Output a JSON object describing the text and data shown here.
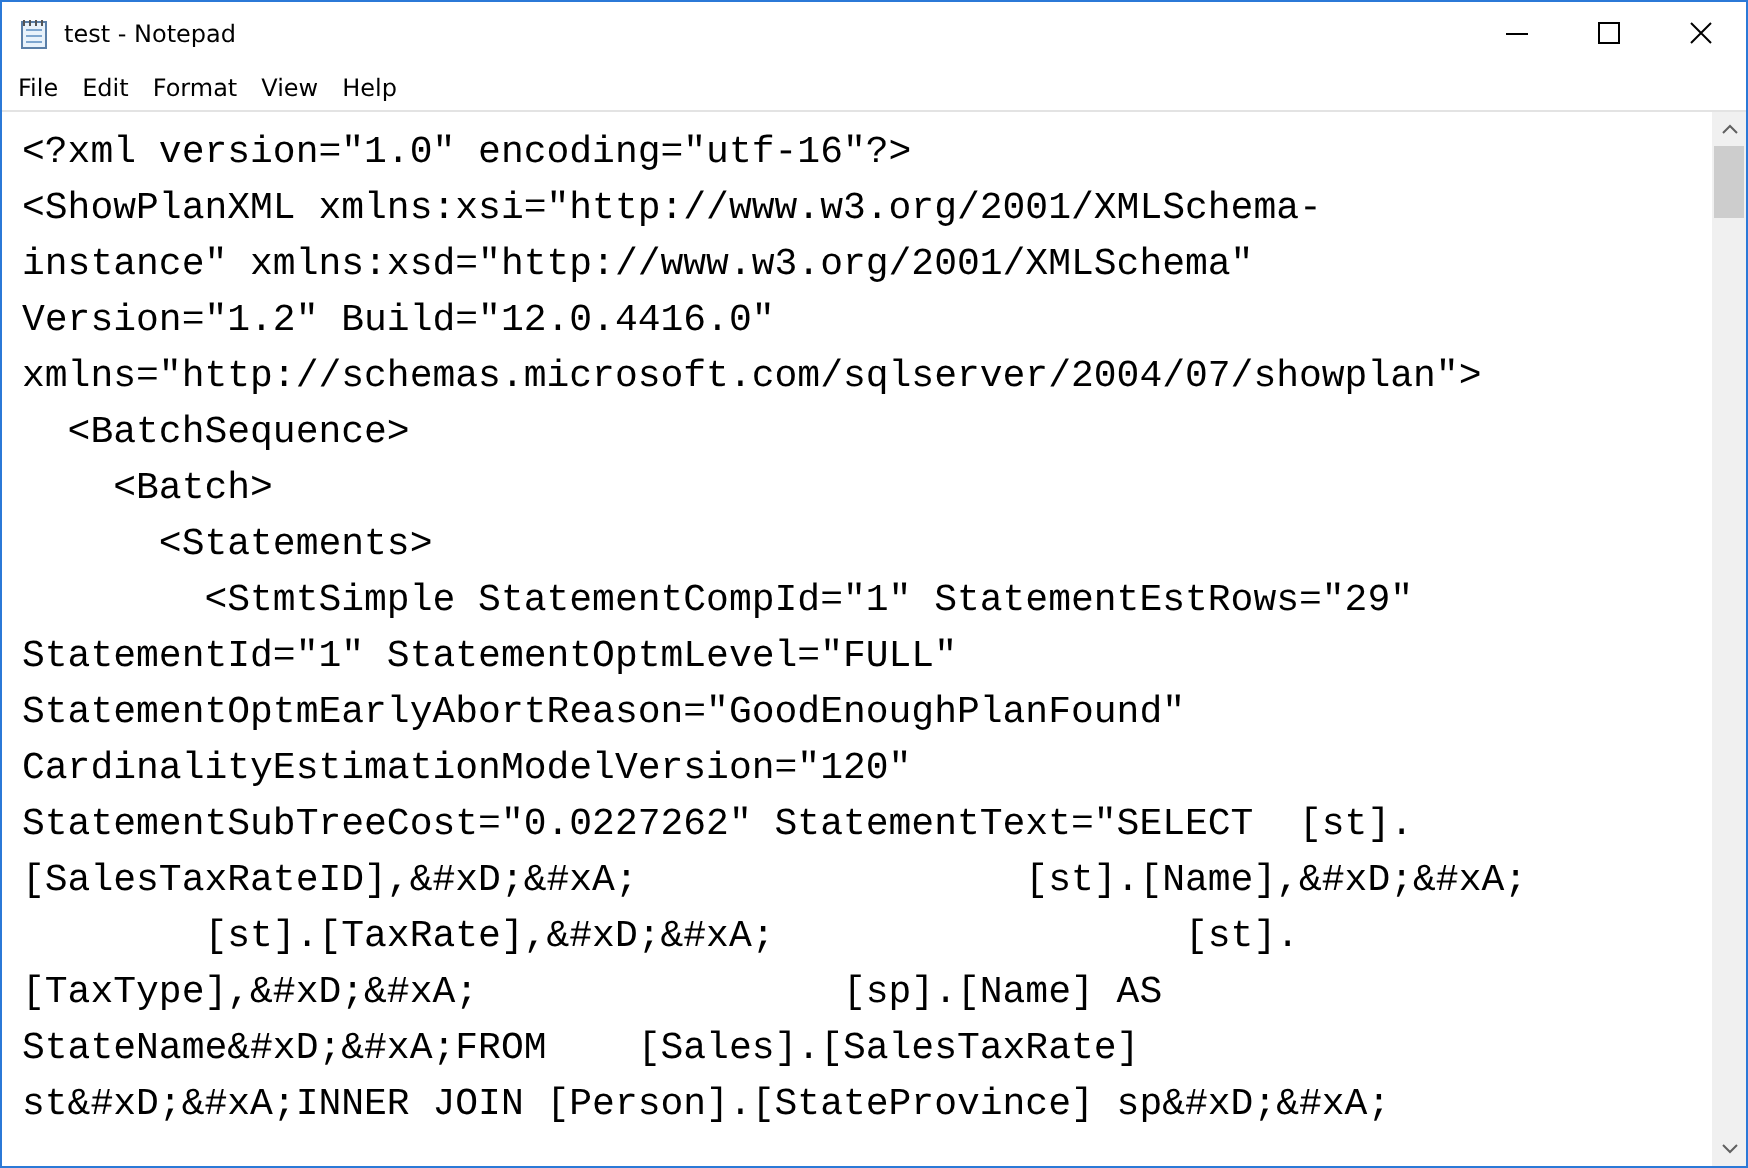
{
  "window": {
    "title": "test - Notepad"
  },
  "menu": [
    "File",
    "Edit",
    "Format",
    "View",
    "Help"
  ],
  "editor": {
    "lines": [
      "<?xml version=\"1.0\" encoding=\"utf-16\"?>",
      "<ShowPlanXML xmlns:xsi=\"http://www.w3.org/2001/XMLSchema-",
      "instance\" xmlns:xsd=\"http://www.w3.org/2001/XMLSchema\"",
      "Version=\"1.2\" Build=\"12.0.4416.0\"",
      "xmlns=\"http://schemas.microsoft.com/sqlserver/2004/07/showplan\">",
      "  <BatchSequence>",
      "    <Batch>",
      "      <Statements>",
      "        <StmtSimple StatementCompId=\"1\" StatementEstRows=\"29\"",
      "StatementId=\"1\" StatementOptmLevel=\"FULL\"",
      "StatementOptmEarlyAbortReason=\"GoodEnoughPlanFound\"",
      "CardinalityEstimationModelVersion=\"120\"",
      "StatementSubTreeCost=\"0.0227262\" StatementText=\"SELECT  [st].",
      "[SalesTaxRateID],&#xD;&#xA;                 [st].[Name],&#xD;&#xA;",
      "        [st].[TaxRate],&#xD;&#xA;                  [st].",
      "[TaxType],&#xD;&#xA;                [sp].[Name] AS",
      "StateName&#xD;&#xA;FROM    [Sales].[SalesTaxRate]",
      "st&#xD;&#xA;INNER JOIN [Person].[StateProvince] sp&#xD;&#xA;"
    ]
  }
}
